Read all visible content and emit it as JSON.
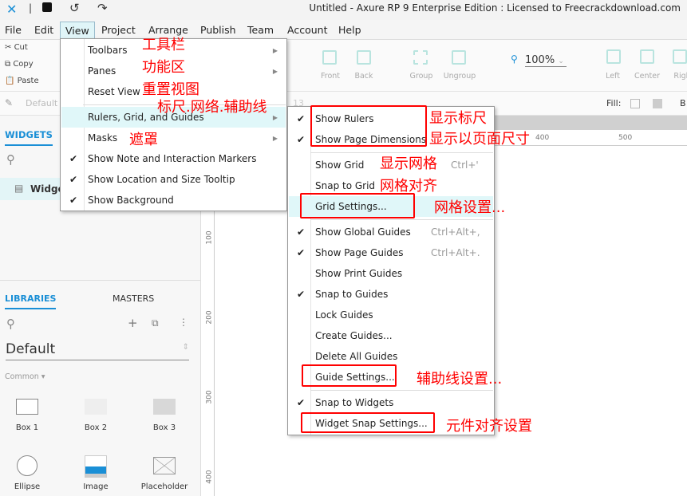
{
  "window": {
    "title": "Untitled - Axure RP 9 Enterprise Edition : Licensed to Freecrackdownload.com"
  },
  "menubar": [
    "File",
    "Edit",
    "View",
    "Project",
    "Arrange",
    "Publish",
    "Team",
    "Account",
    "Help"
  ],
  "clipboard": [
    "Cut",
    "Copy",
    "Paste"
  ],
  "toolbar": {
    "front": "Front",
    "back": "Back",
    "group": "Group",
    "ungroup": "Ungroup",
    "zoom": "100%",
    "left": "Left",
    "center": "Center",
    "right": "Righ",
    "style": "Default",
    "font_size": "13",
    "fill": "Fill:",
    "border": "B"
  },
  "widgets_pane": {
    "tab": "WIDGETS",
    "item": "Widge"
  },
  "libraries_pane": {
    "tab_libraries": "LIBRARIES",
    "tab_masters": "MASTERS",
    "library": "Default",
    "category": "Common ▾",
    "widgets": [
      "Box 1",
      "Box 2",
      "Box 3",
      "Ellipse",
      "Image",
      "Placeholder"
    ]
  },
  "rulers": {
    "h": [
      "400",
      "500"
    ],
    "v": [
      "100",
      "200",
      "300",
      "400"
    ]
  },
  "view_menu": [
    {
      "label": "Toolbars",
      "submenu": true
    },
    {
      "label": "Panes",
      "submenu": true
    },
    {
      "label": "Reset View"
    },
    {
      "label": "Rulers, Grid, and Guides",
      "submenu": true,
      "highlighted": true
    },
    {
      "label": "Masks",
      "submenu": true
    },
    {
      "label": "Show Note and Interaction Markers",
      "checked": true
    },
    {
      "label": "Show Location and Size Tooltip",
      "checked": true
    },
    {
      "label": "Show Background",
      "checked": true
    }
  ],
  "submenu": [
    {
      "label": "Show Rulers",
      "checked": true
    },
    {
      "label": "Show Page Dimensions",
      "checked": true
    },
    {
      "label": "Show Grid",
      "shortcut": "Ctrl+'"
    },
    {
      "label": "Snap to Grid"
    },
    {
      "label": "Grid Settings...",
      "highlighted": true
    },
    {
      "label": "Show Global Guides",
      "checked": true,
      "shortcut": "Ctrl+Alt+,"
    },
    {
      "label": "Show Page Guides",
      "checked": true,
      "shortcut": "Ctrl+Alt+."
    },
    {
      "label": "Show Print Guides"
    },
    {
      "label": "Snap to Guides",
      "checked": true
    },
    {
      "label": "Lock Guides"
    },
    {
      "label": "Create Guides..."
    },
    {
      "label": "Delete All Guides"
    },
    {
      "label": "Guide Settings..."
    },
    {
      "label": "Snap to Widgets",
      "checked": true
    },
    {
      "label": "Widget Snap Settings..."
    }
  ],
  "annotations": {
    "toolbars": "工具栏",
    "panes": "功能区",
    "reset": "重置视图",
    "rulers": "标尺.网络.辅助线",
    "masks": "遮罩",
    "show_rulers": "显示标尺",
    "page_dim": "显示以页面尺寸",
    "grid": "显示网格",
    "snap_grid": "网格对齐",
    "grid_settings": "网格设置...",
    "guide_settings": "辅助线设置...",
    "widget_snap": "元件对齐设置"
  },
  "colors": {
    "accent": "#1a8fd6",
    "annotation": "#ff0000",
    "highlight": "#e0f7f9"
  }
}
